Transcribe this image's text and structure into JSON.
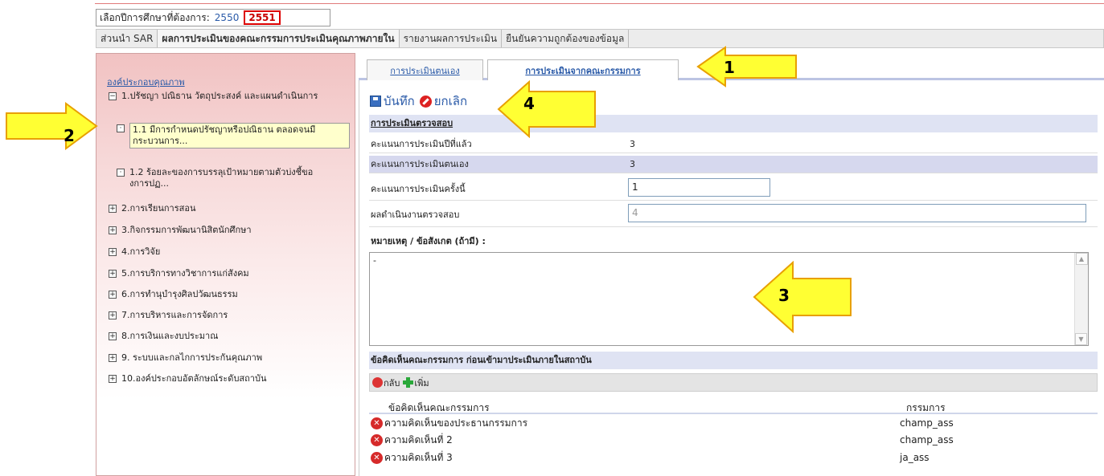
{
  "year_selector": {
    "label": "เลือกปีการศึกษาที่ต้องการ:",
    "years": [
      "2550",
      "2551"
    ],
    "selected": "2551"
  },
  "menu": [
    "ส่วนนำ SAR",
    "ผลการประเมินของคณะกรรมการประเมินคุณภาพภายใน",
    "รายงานผลการประเมิน",
    "ยืนยันความถูกต้องของข้อมูล"
  ],
  "tree": {
    "header": "องค์ประกอบคุณภาพ",
    "nodes": [
      {
        "toggle": "−",
        "label": "1.ปรัชญา ปณิธาน วัตถุประสงค์ และแผนดำเนินการ"
      },
      {
        "toggle": "·",
        "label": "1.1 มีการกำหนดปรัชญาหรือปณิธาน ตลอดจนมีกระบวนการ..."
      },
      {
        "toggle": "·",
        "label": "1.2 ร้อยละของการบรรลุเป้าหมายตามตัวบ่งชี้ของการปฏ..."
      },
      {
        "toggle": "+",
        "label": "2.การเรียนการสอน"
      },
      {
        "toggle": "+",
        "label": "3.กิจกรรมการพัฒนานิสิตนักศึกษา"
      },
      {
        "toggle": "+",
        "label": "4.การวิจัย"
      },
      {
        "toggle": "+",
        "label": "5.การบริการทางวิชาการแก่สังคม"
      },
      {
        "toggle": "+",
        "label": "6.การทำนุบำรุงศิลปวัฒนธรรม"
      },
      {
        "toggle": "+",
        "label": "7.การบริหารและการจัดการ"
      },
      {
        "toggle": "+",
        "label": "8.การเงินและงบประมาณ"
      },
      {
        "toggle": "+",
        "label": "9. ระบบและกลไกการประกันคุณภาพ"
      },
      {
        "toggle": "+",
        "label": "10.องค์ประกอบอัตลักษณ์ระดับสถาบัน"
      }
    ]
  },
  "tabs": [
    "การประเมินตนเอง",
    "การประเมินจากคณะกรรมการ"
  ],
  "toolbar": {
    "save": "บันทึก",
    "cancel": "ยกเลิก"
  },
  "assessment": {
    "title": "การประเมินตรวจสอบ",
    "rows": [
      {
        "label": "คะแนนการประเมินปีที่แล้ว",
        "value": "3"
      },
      {
        "label": "คะแนนการประเมินตนเอง",
        "value": "3"
      },
      {
        "label": "คะแนนการประเมินครั้งนี้",
        "value": "1"
      },
      {
        "label": "ผลดำเนินงานตรวจสอบ",
        "value": "4"
      }
    ]
  },
  "notes": {
    "title": "หมายเหตุ / ข้อสังเกต (ถ้ามี) :",
    "value": "-"
  },
  "comments": {
    "title": "ข้อคิดเห็นคณะกรรมการ ก่อนเข้ามาประเมินภายในสถาบัน",
    "back": "กลับ",
    "add": "เพิ่ม",
    "col_comment": "ข้อคิดเห็นคณะกรรมการ",
    "col_committee": "กรรมการ",
    "rows": [
      {
        "text": "ความคิดเห็นของประธานกรรมการ",
        "committee": "champ_ass"
      },
      {
        "text": "ความคิดเห็นที่ 2",
        "committee": "champ_ass"
      },
      {
        "text": "ความคิดเห็นที่ 3",
        "committee": "ja_ass"
      }
    ]
  },
  "callouts": [
    "1",
    "2",
    "3",
    "4"
  ],
  "colors": {
    "arrow_fill": "#ffff33",
    "arrow_stroke": "#e8a000",
    "tree_bg": "#f1c2c2",
    "section_bg": "#dfe3f3",
    "link": "#2a5aa8"
  }
}
